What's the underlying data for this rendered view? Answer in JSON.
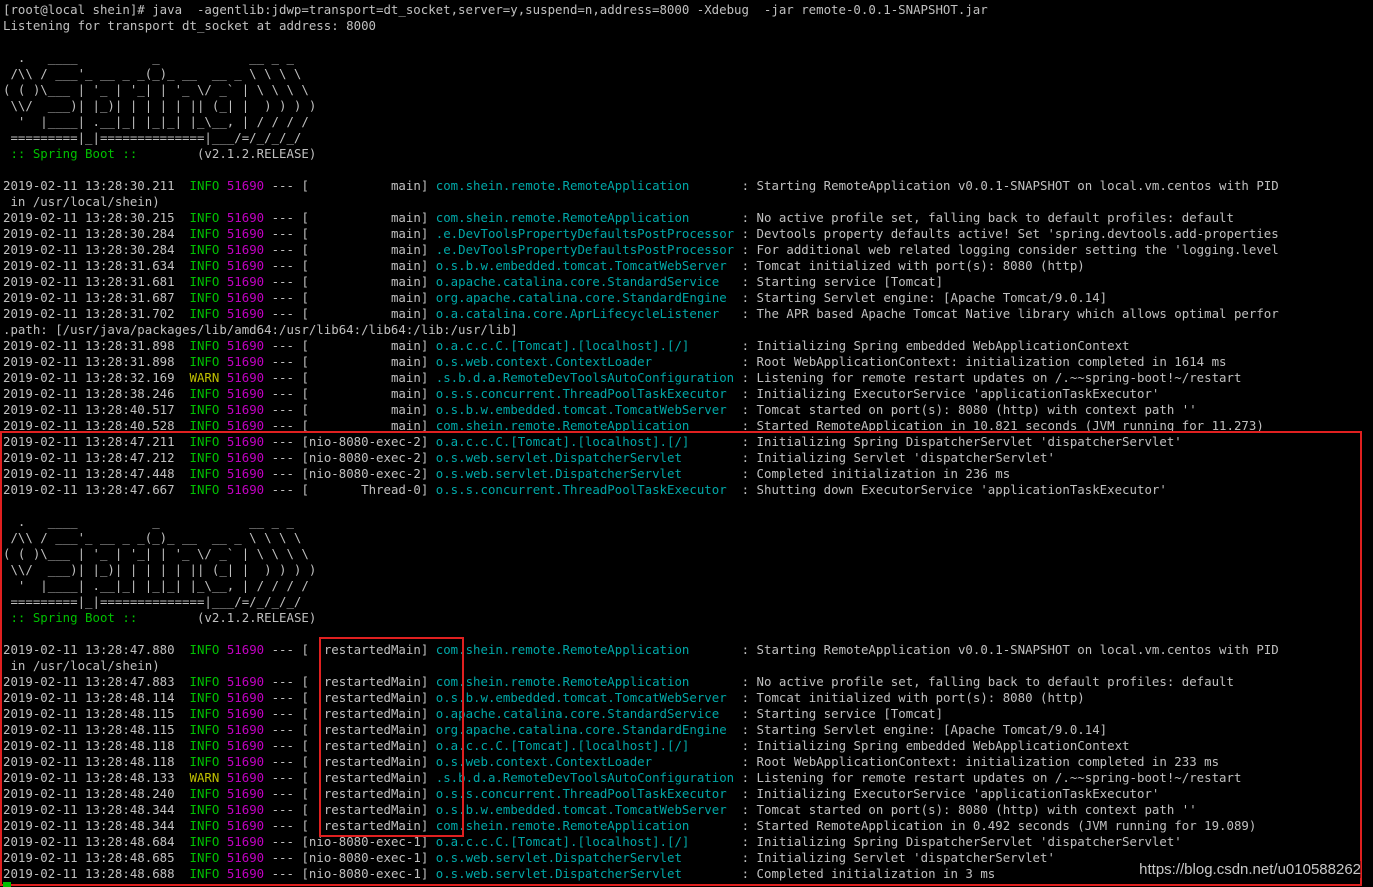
{
  "terminal": {
    "lines": [
      {
        "kind": "plain",
        "text": "[root@local shein]# java  -agentlib:jdwp=transport=dt_socket,server=y,suspend=n,address=8000 -Xdebug  -jar remote-0.0.1-SNAPSHOT.jar"
      },
      {
        "kind": "plain",
        "text": "Listening for transport dt_socket at address: 8000"
      },
      {
        "kind": "plain",
        "text": ""
      },
      {
        "kind": "plain",
        "text": "  .   ____          _            __ _ _"
      },
      {
        "kind": "plain",
        "text": " /\\\\ / ___'_ __ _ _(_)_ __  __ _ \\ \\ \\ \\"
      },
      {
        "kind": "plain",
        "text": "( ( )\\___ | '_ | '_| | '_ \\/ _` | \\ \\ \\ \\"
      },
      {
        "kind": "plain",
        "text": " \\\\/  ___)| |_)| | | | | || (_| |  ) ) ) )"
      },
      {
        "kind": "plain",
        "text": "  '  |____| .__|_| |_|_| |_\\__, | / / / /"
      },
      {
        "kind": "plain",
        "text": " =========|_|==============|___/=/_/_/_/"
      },
      {
        "kind": "banner",
        "label": " :: Spring Boot :: ",
        "version": "       (v2.1.2.RELEASE)"
      },
      {
        "kind": "plain",
        "text": ""
      },
      {
        "kind": "log",
        "time": "2019-02-11 13:28:30.211",
        "level": "INFO",
        "pid": "51690",
        "thread": "           main",
        "logger": "com.shein.remote.RemoteApplication      ",
        "msg": "Starting RemoteApplication v0.0.1-SNAPSHOT on local.vm.centos with PID"
      },
      {
        "kind": "plain",
        "text": " in /usr/local/shein)"
      },
      {
        "kind": "log",
        "time": "2019-02-11 13:28:30.215",
        "level": "INFO",
        "pid": "51690",
        "thread": "           main",
        "logger": "com.shein.remote.RemoteApplication      ",
        "msg": "No active profile set, falling back to default profiles: default"
      },
      {
        "kind": "log",
        "time": "2019-02-11 13:28:30.284",
        "level": "INFO",
        "pid": "51690",
        "thread": "           main",
        "logger": ".e.DevToolsPropertyDefaultsPostProcessor",
        "msg": "Devtools property defaults active! Set 'spring.devtools.add-properties"
      },
      {
        "kind": "log",
        "time": "2019-02-11 13:28:30.284",
        "level": "INFO",
        "pid": "51690",
        "thread": "           main",
        "logger": ".e.DevToolsPropertyDefaultsPostProcessor",
        "msg": "For additional web related logging consider setting the 'logging.level"
      },
      {
        "kind": "log",
        "time": "2019-02-11 13:28:31.634",
        "level": "INFO",
        "pid": "51690",
        "thread": "           main",
        "logger": "o.s.b.w.embedded.tomcat.TomcatWebServer ",
        "msg": "Tomcat initialized with port(s): 8080 (http)"
      },
      {
        "kind": "log",
        "time": "2019-02-11 13:28:31.681",
        "level": "INFO",
        "pid": "51690",
        "thread": "           main",
        "logger": "o.apache.catalina.core.StandardService  ",
        "msg": "Starting service [Tomcat]"
      },
      {
        "kind": "log",
        "time": "2019-02-11 13:28:31.687",
        "level": "INFO",
        "pid": "51690",
        "thread": "           main",
        "logger": "org.apache.catalina.core.StandardEngine ",
        "msg": "Starting Servlet engine: [Apache Tomcat/9.0.14]"
      },
      {
        "kind": "log",
        "time": "2019-02-11 13:28:31.702",
        "level": "INFO",
        "pid": "51690",
        "thread": "           main",
        "logger": "o.a.catalina.core.AprLifecycleListener  ",
        "msg": "The APR based Apache Tomcat Native library which allows optimal perfor"
      },
      {
        "kind": "plain",
        "text": ".path: [/usr/java/packages/lib/amd64:/usr/lib64:/lib64:/lib:/usr/lib]"
      },
      {
        "kind": "log",
        "time": "2019-02-11 13:28:31.898",
        "level": "INFO",
        "pid": "51690",
        "thread": "           main",
        "logger": "o.a.c.c.C.[Tomcat].[localhost].[/]      ",
        "msg": "Initializing Spring embedded WebApplicationContext"
      },
      {
        "kind": "log",
        "time": "2019-02-11 13:28:31.898",
        "level": "INFO",
        "pid": "51690",
        "thread": "           main",
        "logger": "o.s.web.context.ContextLoader           ",
        "msg": "Root WebApplicationContext: initialization completed in 1614 ms"
      },
      {
        "kind": "log",
        "time": "2019-02-11 13:28:32.169",
        "level": "WARN",
        "pid": "51690",
        "thread": "           main",
        "logger": ".s.b.d.a.RemoteDevToolsAutoConfiguration",
        "msg": "Listening for remote restart updates on /.~~spring-boot!~/restart"
      },
      {
        "kind": "log",
        "time": "2019-02-11 13:28:38.246",
        "level": "INFO",
        "pid": "51690",
        "thread": "           main",
        "logger": "o.s.s.concurrent.ThreadPoolTaskExecutor ",
        "msg": "Initializing ExecutorService 'applicationTaskExecutor'"
      },
      {
        "kind": "log",
        "time": "2019-02-11 13:28:40.517",
        "level": "INFO",
        "pid": "51690",
        "thread": "           main",
        "logger": "o.s.b.w.embedded.tomcat.TomcatWebServer ",
        "msg": "Tomcat started on port(s): 8080 (http) with context path ''"
      },
      {
        "kind": "log",
        "time": "2019-02-11 13:28:40.528",
        "level": "INFO",
        "pid": "51690",
        "thread": "           main",
        "logger": "com.shein.remote.RemoteApplication      ",
        "msg": "Started RemoteApplication in 10.821 seconds (JVM running for 11.273)"
      },
      {
        "kind": "log",
        "time": "2019-02-11 13:28:47.211",
        "level": "INFO",
        "pid": "51690",
        "thread": "nio-8080-exec-2",
        "logger": "o.a.c.c.C.[Tomcat].[localhost].[/]      ",
        "msg": "Initializing Spring DispatcherServlet 'dispatcherServlet'"
      },
      {
        "kind": "log",
        "time": "2019-02-11 13:28:47.212",
        "level": "INFO",
        "pid": "51690",
        "thread": "nio-8080-exec-2",
        "logger": "o.s.web.servlet.DispatcherServlet       ",
        "msg": "Initializing Servlet 'dispatcherServlet'"
      },
      {
        "kind": "log",
        "time": "2019-02-11 13:28:47.448",
        "level": "INFO",
        "pid": "51690",
        "thread": "nio-8080-exec-2",
        "logger": "o.s.web.servlet.DispatcherServlet       ",
        "msg": "Completed initialization in 236 ms"
      },
      {
        "kind": "log",
        "time": "2019-02-11 13:28:47.667",
        "level": "INFO",
        "pid": "51690",
        "thread": "       Thread-0",
        "logger": "o.s.s.concurrent.ThreadPoolTaskExecutor ",
        "msg": "Shutting down ExecutorService 'applicationTaskExecutor'"
      },
      {
        "kind": "plain",
        "text": ""
      },
      {
        "kind": "plain",
        "text": "  .   ____          _            __ _ _"
      },
      {
        "kind": "plain",
        "text": " /\\\\ / ___'_ __ _ _(_)_ __  __ _ \\ \\ \\ \\"
      },
      {
        "kind": "plain",
        "text": "( ( )\\___ | '_ | '_| | '_ \\/ _` | \\ \\ \\ \\"
      },
      {
        "kind": "plain",
        "text": " \\\\/  ___)| |_)| | | | | || (_| |  ) ) ) )"
      },
      {
        "kind": "plain",
        "text": "  '  |____| .__|_| |_|_| |_\\__, | / / / /"
      },
      {
        "kind": "plain",
        "text": " =========|_|==============|___/=/_/_/_/"
      },
      {
        "kind": "banner",
        "label": " :: Spring Boot :: ",
        "version": "       (v2.1.2.RELEASE)"
      },
      {
        "kind": "plain",
        "text": ""
      },
      {
        "kind": "log",
        "time": "2019-02-11 13:28:47.880",
        "level": "INFO",
        "pid": "51690",
        "thread": "  restartedMain",
        "logger": "com.shein.remote.RemoteApplication      ",
        "msg": "Starting RemoteApplication v0.0.1-SNAPSHOT on local.vm.centos with PID"
      },
      {
        "kind": "plain",
        "text": " in /usr/local/shein)"
      },
      {
        "kind": "log",
        "time": "2019-02-11 13:28:47.883",
        "level": "INFO",
        "pid": "51690",
        "thread": "  restartedMain",
        "logger": "com.shein.remote.RemoteApplication      ",
        "msg": "No active profile set, falling back to default profiles: default"
      },
      {
        "kind": "log",
        "time": "2019-02-11 13:28:48.114",
        "level": "INFO",
        "pid": "51690",
        "thread": "  restartedMain",
        "logger": "o.s.b.w.embedded.tomcat.TomcatWebServer ",
        "msg": "Tomcat initialized with port(s): 8080 (http)"
      },
      {
        "kind": "log",
        "time": "2019-02-11 13:28:48.115",
        "level": "INFO",
        "pid": "51690",
        "thread": "  restartedMain",
        "logger": "o.apache.catalina.core.StandardService  ",
        "msg": "Starting service [Tomcat]"
      },
      {
        "kind": "log",
        "time": "2019-02-11 13:28:48.115",
        "level": "INFO",
        "pid": "51690",
        "thread": "  restartedMain",
        "logger": "org.apache.catalina.core.StandardEngine ",
        "msg": "Starting Servlet engine: [Apache Tomcat/9.0.14]"
      },
      {
        "kind": "log",
        "time": "2019-02-11 13:28:48.118",
        "level": "INFO",
        "pid": "51690",
        "thread": "  restartedMain",
        "logger": "o.a.c.c.C.[Tomcat].[localhost].[/]      ",
        "msg": "Initializing Spring embedded WebApplicationContext"
      },
      {
        "kind": "log",
        "time": "2019-02-11 13:28:48.118",
        "level": "INFO",
        "pid": "51690",
        "thread": "  restartedMain",
        "logger": "o.s.web.context.ContextLoader           ",
        "msg": "Root WebApplicationContext: initialization completed in 233 ms"
      },
      {
        "kind": "log",
        "time": "2019-02-11 13:28:48.133",
        "level": "WARN",
        "pid": "51690",
        "thread": "  restartedMain",
        "logger": ".s.b.d.a.RemoteDevToolsAutoConfiguration",
        "msg": "Listening for remote restart updates on /.~~spring-boot!~/restart"
      },
      {
        "kind": "log",
        "time": "2019-02-11 13:28:48.240",
        "level": "INFO",
        "pid": "51690",
        "thread": "  restartedMain",
        "logger": "o.s.s.concurrent.ThreadPoolTaskExecutor ",
        "msg": "Initializing ExecutorService 'applicationTaskExecutor'"
      },
      {
        "kind": "log",
        "time": "2019-02-11 13:28:48.344",
        "level": "INFO",
        "pid": "51690",
        "thread": "  restartedMain",
        "logger": "o.s.b.w.embedded.tomcat.TomcatWebServer ",
        "msg": "Tomcat started on port(s): 8080 (http) with context path ''"
      },
      {
        "kind": "log",
        "time": "2019-02-11 13:28:48.344",
        "level": "INFO",
        "pid": "51690",
        "thread": "  restartedMain",
        "logger": "com.shein.remote.RemoteApplication      ",
        "msg": "Started RemoteApplication in 0.492 seconds (JVM running for 19.089)"
      },
      {
        "kind": "log",
        "time": "2019-02-11 13:28:48.684",
        "level": "INFO",
        "pid": "51690",
        "thread": "nio-8080-exec-1",
        "logger": "o.a.c.c.C.[Tomcat].[localhost].[/]      ",
        "msg": "Initializing Spring DispatcherServlet 'dispatcherServlet'"
      },
      {
        "kind": "log",
        "time": "2019-02-11 13:28:48.685",
        "level": "INFO",
        "pid": "51690",
        "thread": "nio-8080-exec-1",
        "logger": "o.s.web.servlet.DispatcherServlet       ",
        "msg": "Initializing Servlet 'dispatcherServlet'"
      },
      {
        "kind": "log",
        "time": "2019-02-11 13:28:48.688",
        "level": "INFO",
        "pid": "51690",
        "thread": "nio-8080-exec-1",
        "logger": "o.s.web.servlet.DispatcherServlet       ",
        "msg": "Completed initialization in 3 ms"
      }
    ],
    "separator": " --- ",
    "colors": {
      "background": "#000000",
      "text": "#c0c0c0",
      "info": "#00c000",
      "warn": "#c0c000",
      "pid": "#c000c0",
      "logger": "#00a8a8",
      "highlight_box": "#e02020"
    }
  },
  "watermark": "https://blog.csdn.net/u010588262"
}
